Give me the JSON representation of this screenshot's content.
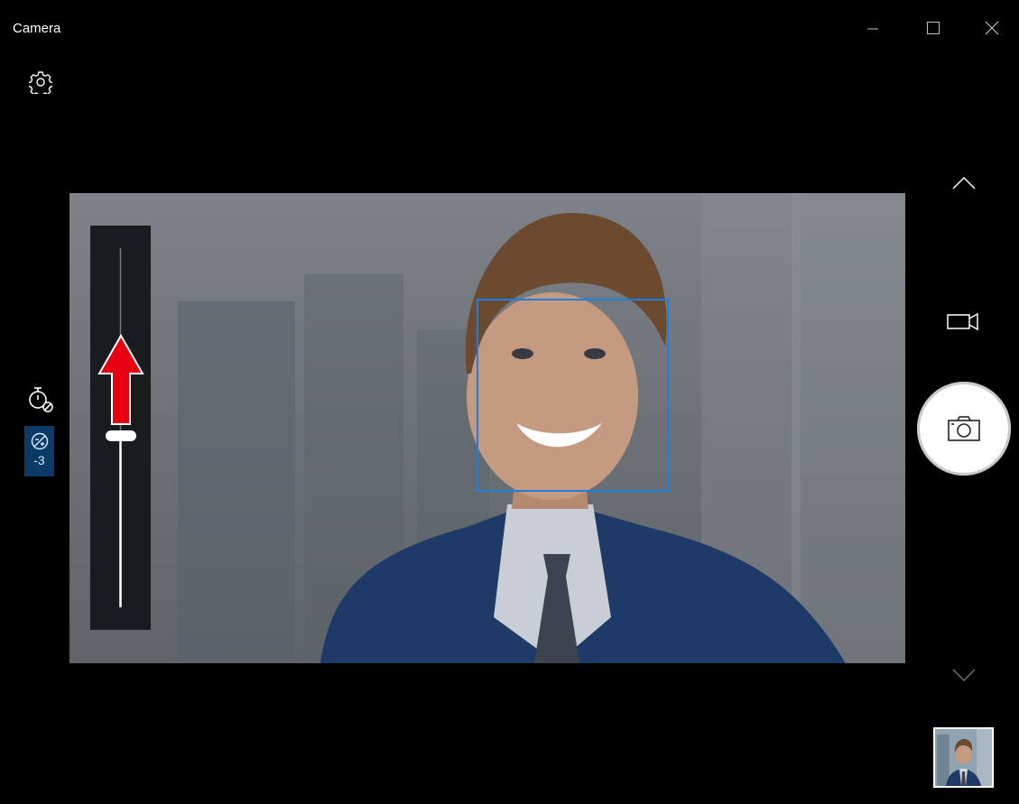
{
  "window": {
    "title": "Camera",
    "controls": [
      "minimize",
      "maximize",
      "close"
    ]
  },
  "toolbar": {
    "settings_icon": "gear-icon"
  },
  "left_controls": {
    "timer_icon": "timer-off-icon",
    "exposure_icon": "exposure-icon",
    "exposure_value": "-3",
    "exposure_slider_level": 0.52
  },
  "viewfinder": {
    "face_detected": true,
    "face_box_color": "#1e7fe0",
    "annotation_arrow_color": "#e60012"
  },
  "right_controls": {
    "scroll_up_icon": "chevron-up-icon",
    "video_mode_icon": "video-camera-icon",
    "shutter_icon": "camera-icon",
    "scroll_down_icon": "chevron-down-icon",
    "last_capture_thumbnail": "photo-thumbnail"
  }
}
